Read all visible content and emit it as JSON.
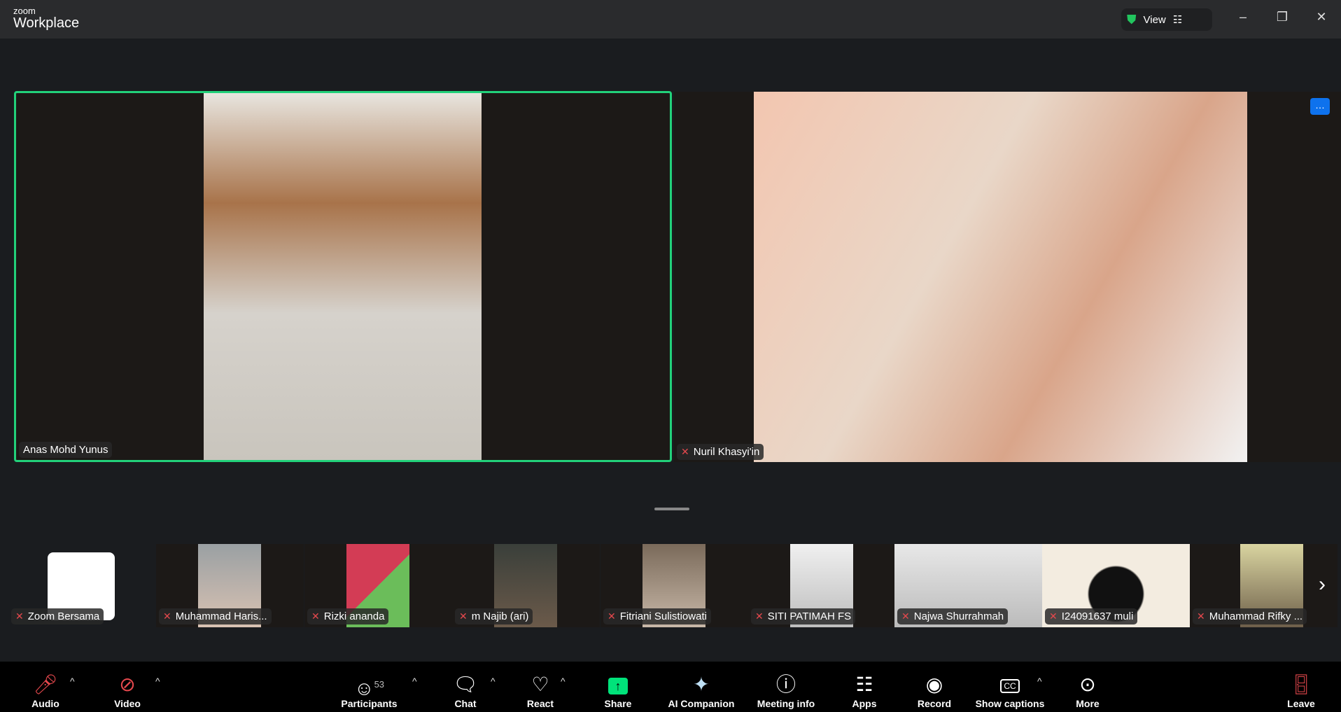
{
  "app": {
    "brand_small": "zoom",
    "brand_large": "Workplace",
    "view_label": "View"
  },
  "main": {
    "speaker1": {
      "name": "Anas Mohd Yunus"
    },
    "speaker2": {
      "name": "Nuril Khasyi'in"
    }
  },
  "thumbnails": [
    {
      "name": "Zoom Bersama"
    },
    {
      "name": "Muhammad Haris..."
    },
    {
      "name": "Rizki ananda"
    },
    {
      "name": "m Najib (ari)"
    },
    {
      "name": "Fitriani Sulistiowati"
    },
    {
      "name": "SITI PATIMAH FS"
    },
    {
      "name": "Najwa Shurrahmah"
    },
    {
      "name": "I24091637 muli"
    },
    {
      "name": "Muhammad Rifky ..."
    }
  ],
  "toolbar": {
    "audio": "Audio",
    "video": "Video",
    "participants": "Participants",
    "participants_count": "53",
    "chat": "Chat",
    "react": "React",
    "share": "Share",
    "ai": "AI Companion",
    "info": "Meeting info",
    "apps": "Apps",
    "record": "Record",
    "captions": "Show captions",
    "more": "More",
    "leave": "Leave"
  },
  "colors": {
    "active_border": "#22d17a",
    "share": "#00e27a",
    "muted": "#e5484d"
  }
}
